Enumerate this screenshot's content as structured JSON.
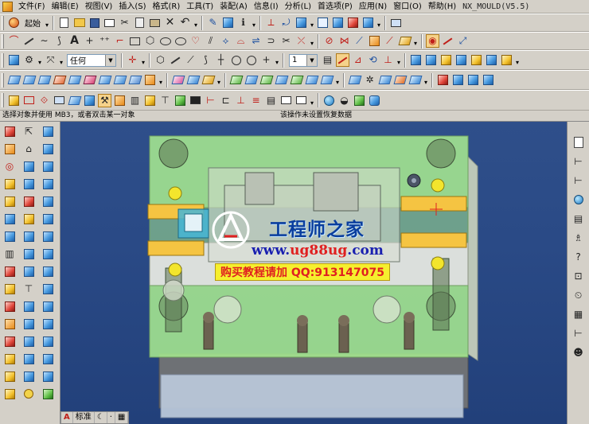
{
  "menubar": {
    "items": [
      "文件(F)",
      "编辑(E)",
      "视图(V)",
      "插入(S)",
      "格式(R)",
      "工具(T)",
      "装配(A)",
      "信息(I)",
      "分析(L)",
      "首选项(P)",
      "应用(N)",
      "窗口(O)",
      "帮助(H)"
    ],
    "app_title": "NX_MOULD(V5.5)"
  },
  "toolbar": {
    "start_label": "起始",
    "filter_value": "任何",
    "layer_value": "1"
  },
  "cue": {
    "prompt": "选择对象并使用 MB3，或者双击某一对象",
    "status": "该操作未设置恢复数据"
  },
  "watermark": {
    "title": "工程师之家",
    "url_prefix": "www.",
    "url_highlight": "ug88ug",
    "url_suffix": ".com",
    "banner": "购买教程请加 QQ:913147075"
  },
  "bottom_bar": {
    "style_label": "标准"
  },
  "colors": {
    "viewport_bg": "#2a4a86",
    "mold_plate": "#a6e890",
    "slide": "#f5c442",
    "accent_red": "#e02020"
  },
  "icons": {
    "file_new": "new-file-icon",
    "open": "open-folder-icon",
    "save": "save-icon",
    "globe": "globe-icon"
  }
}
